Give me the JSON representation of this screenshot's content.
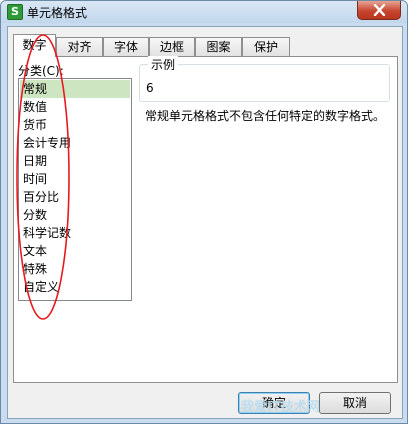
{
  "window": {
    "title": "单元格格式",
    "icon": "spreadsheet-app-icon",
    "icon_glyph": "S"
  },
  "tabs": [
    {
      "label": "数字",
      "active": true
    },
    {
      "label": "对齐",
      "active": false
    },
    {
      "label": "字体",
      "active": false
    },
    {
      "label": "边框",
      "active": false
    },
    {
      "label": "图案",
      "active": false
    },
    {
      "label": "保护",
      "active": false
    }
  ],
  "category": {
    "label": "分类(C):",
    "items": [
      "常规",
      "数值",
      "货币",
      "会计专用",
      "日期",
      "时间",
      "百分比",
      "分数",
      "科学记数",
      "文本",
      "特殊",
      "自定义"
    ],
    "selected": "常规"
  },
  "sample": {
    "legend": "示例",
    "value": "6"
  },
  "description": "常规单元格格式不包含任何特定的数字格式。",
  "buttons": {
    "ok": "确定",
    "cancel": "取消"
  },
  "watermark": "我爱IT技术网",
  "colors": {
    "selection": "#cde5c0",
    "annotation": "#e8191e",
    "close": "#c7462f"
  }
}
